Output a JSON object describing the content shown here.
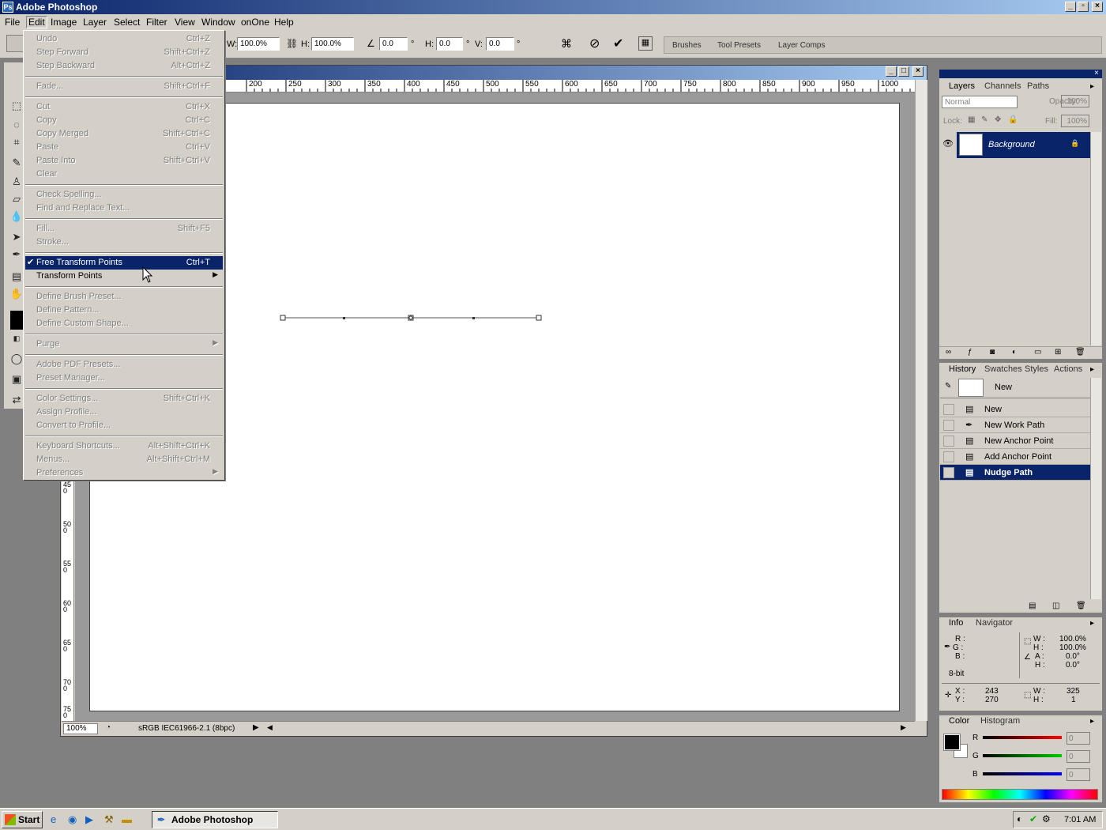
{
  "app": {
    "title": "Adobe Photoshop"
  },
  "menubar": [
    "File",
    "Edit",
    "Image",
    "Layer",
    "Select",
    "Filter",
    "View",
    "Window",
    "onOne",
    "Help"
  ],
  "options": {
    "w_label": "W:",
    "w_value": "100.0%",
    "h_label": "H:",
    "h_value": "100.0%",
    "angle_value": "0.0",
    "deg": "°",
    "hskew_label": "H:",
    "hskew_value": "0.0",
    "vskew_label": "V:",
    "vskew_value": "0.0"
  },
  "palette_well": [
    "Brushes",
    "Tool Presets",
    "Layer Comps"
  ],
  "edit_menu": [
    {
      "label": "Undo",
      "shortcut": "Ctrl+Z",
      "disabled": true
    },
    {
      "label": "Step Forward",
      "shortcut": "Shift+Ctrl+Z",
      "disabled": true
    },
    {
      "label": "Step Backward",
      "shortcut": "Alt+Ctrl+Z",
      "disabled": true
    },
    {
      "sep": true
    },
    {
      "label": "Fade...",
      "shortcut": "Shift+Ctrl+F",
      "disabled": true
    },
    {
      "sep": true
    },
    {
      "label": "Cut",
      "shortcut": "Ctrl+X",
      "disabled": true
    },
    {
      "label": "Copy",
      "shortcut": "Ctrl+C",
      "disabled": true
    },
    {
      "label": "Copy Merged",
      "shortcut": "Shift+Ctrl+C",
      "disabled": true
    },
    {
      "label": "Paste",
      "shortcut": "Ctrl+V",
      "disabled": true
    },
    {
      "label": "Paste Into",
      "shortcut": "Shift+Ctrl+V",
      "disabled": true
    },
    {
      "label": "Clear",
      "shortcut": "",
      "disabled": true
    },
    {
      "sep": true
    },
    {
      "label": "Check Spelling...",
      "shortcut": "",
      "disabled": true
    },
    {
      "label": "Find and Replace Text...",
      "shortcut": "",
      "disabled": true
    },
    {
      "sep": true
    },
    {
      "label": "Fill...",
      "shortcut": "Shift+F5",
      "disabled": true
    },
    {
      "label": "Stroke...",
      "shortcut": "",
      "disabled": true
    },
    {
      "sep": true
    },
    {
      "label": "Free Transform Points",
      "shortcut": "Ctrl+T",
      "disabled": false,
      "highlighted": true,
      "checked": true
    },
    {
      "label": "Transform Points",
      "shortcut": "",
      "disabled": false,
      "submenu": true
    },
    {
      "sep": true
    },
    {
      "label": "Define Brush Preset...",
      "shortcut": "",
      "disabled": true
    },
    {
      "label": "Define Pattern...",
      "shortcut": "",
      "disabled": true
    },
    {
      "label": "Define Custom Shape...",
      "shortcut": "",
      "disabled": true
    },
    {
      "sep": true
    },
    {
      "label": "Purge",
      "shortcut": "",
      "disabled": true,
      "submenu": true
    },
    {
      "sep": true
    },
    {
      "label": "Adobe PDF Presets...",
      "shortcut": "",
      "disabled": true
    },
    {
      "label": "Preset Manager...",
      "shortcut": "",
      "disabled": true
    },
    {
      "sep": true
    },
    {
      "label": "Color Settings...",
      "shortcut": "Shift+Ctrl+K",
      "disabled": true
    },
    {
      "label": "Assign Profile...",
      "shortcut": "",
      "disabled": true
    },
    {
      "label": "Convert to Profile...",
      "shortcut": "",
      "disabled": true
    },
    {
      "sep": true
    },
    {
      "label": "Keyboard Shortcuts...",
      "shortcut": "Alt+Shift+Ctrl+K",
      "disabled": true
    },
    {
      "label": "Menus...",
      "shortcut": "Alt+Shift+Ctrl+M",
      "disabled": true
    },
    {
      "label": "Preferences",
      "shortcut": "",
      "disabled": true,
      "submenu": true
    }
  ],
  "ruler_h": [
    "200",
    "250",
    "300",
    "350",
    "400",
    "450",
    "500",
    "550",
    "600",
    "650",
    "700",
    "750",
    "800",
    "850",
    "900",
    "950",
    "1000"
  ],
  "ruler_v": [
    "450",
    "500",
    "550",
    "600",
    "650",
    "700",
    "750"
  ],
  "status": {
    "zoom": "100%",
    "profile": "sRGB IEC61966-2.1 (8bpc)"
  },
  "layers": {
    "tabs": [
      "Layers",
      "Channels",
      "Paths"
    ],
    "blend_mode": "Normal",
    "opacity_label": "Opacity:",
    "opacity_value": "100%",
    "lock_label": "Lock:",
    "fill_label": "Fill:",
    "fill_value": "100%",
    "layer_name": "Background"
  },
  "history": {
    "tabs": [
      "History",
      "Swatches",
      "Styles",
      "Actions"
    ],
    "snapshot": "New",
    "items": [
      "New",
      "New Work Path",
      "New Anchor Point",
      "Add Anchor Point",
      "Nudge Path"
    ],
    "selected_index": 4
  },
  "info": {
    "tabs": [
      "Info",
      "Navigator"
    ],
    "r_label": "R :",
    "g_label": "G :",
    "b_label": "B :",
    "bit": "8-bit",
    "w_label": "W :",
    "w_value": "100.0%",
    "h_label": "H :",
    "h_value": "100.0%",
    "a_label": "A :",
    "a_value": "0.0°",
    "hh_label": "H :",
    "hh_value": "0.0°",
    "x_label": "X :",
    "x_value": "243",
    "y_label": "Y :",
    "y_value": "270",
    "w2_label": "W :",
    "w2_value": "325",
    "h2_label": "H :",
    "h2_value": "1"
  },
  "color": {
    "tabs": [
      "Color",
      "Histogram"
    ],
    "r_label": "R",
    "r_value": "0",
    "g_label": "G",
    "g_value": "0",
    "b_label": "B",
    "b_value": "0",
    "foreground": "#000000",
    "background": "#ffffff"
  },
  "taskbar": {
    "start": "Start",
    "app": "Adobe Photoshop",
    "clock": "7:01 AM"
  },
  "colors": {
    "titlebar": "#0a246a",
    "menu_highlight": "#0a246a",
    "face": "#d4d0c8"
  }
}
